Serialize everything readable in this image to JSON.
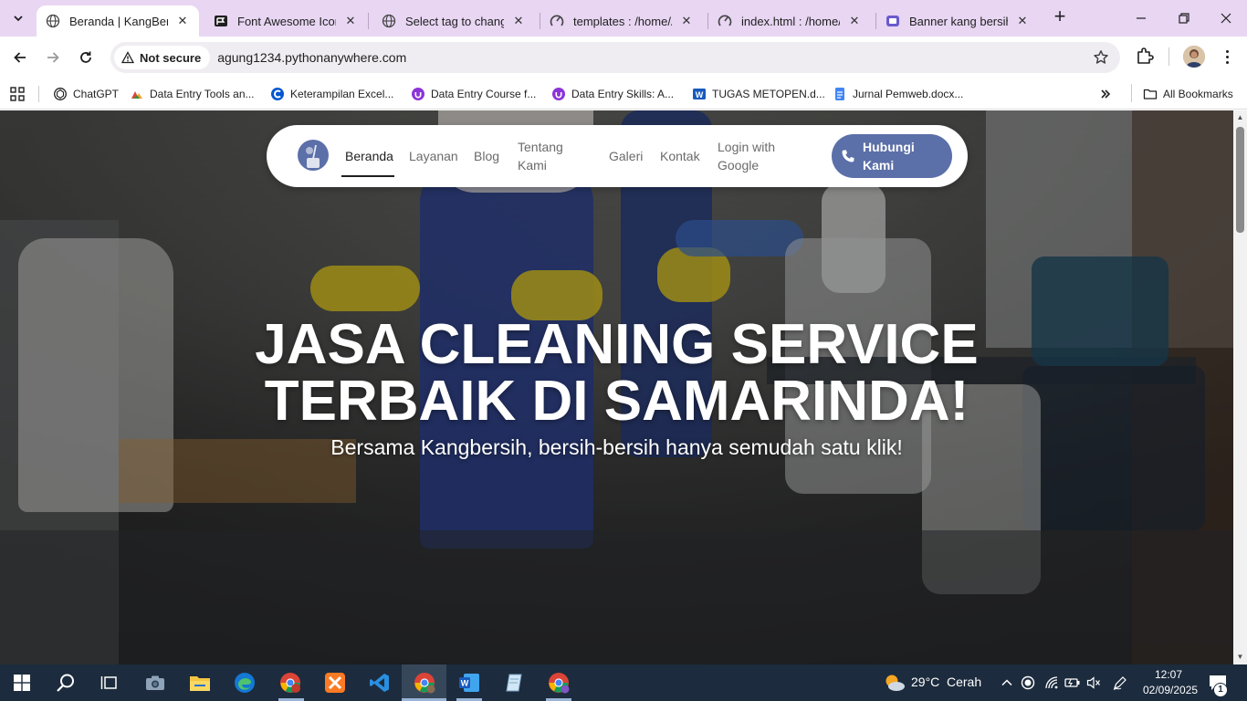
{
  "browser": {
    "tabs": [
      {
        "title": "Beranda | KangBersih",
        "icon": "kangbersih-favicon",
        "active": true
      },
      {
        "title": "Font Awesome Icons",
        "icon": "font-awesome-icon"
      },
      {
        "title": "Select tag to change",
        "icon": "globe-icon"
      },
      {
        "title": "templates : /home/Ag",
        "icon": "pythonanywhere-icon"
      },
      {
        "title": "index.html : /home/A",
        "icon": "pythonanywhere-icon"
      },
      {
        "title": "Banner kang bersih -",
        "icon": "canva-icon"
      }
    ],
    "security_label": "Not secure",
    "url": "agung1234.pythonanywhere.com",
    "bookmarks": [
      {
        "label": "ChatGPT",
        "icon": "chatgpt-icon"
      },
      {
        "label": "Data Entry Tools an...",
        "icon": "tools-icon"
      },
      {
        "label": "Keterampilan Excel...",
        "icon": "coursera-icon"
      },
      {
        "label": "Data Entry Course f...",
        "icon": "udemy-icon"
      },
      {
        "label": "Data Entry Skills: A...",
        "icon": "udemy-icon"
      },
      {
        "label": "TUGAS METOPEN.d...",
        "icon": "word-icon"
      },
      {
        "label": "Jurnal Pemweb.docx...",
        "icon": "docs-icon"
      }
    ],
    "all_bookmarks_label": "All Bookmarks"
  },
  "site": {
    "nav": {
      "links": [
        "Beranda",
        "Layanan",
        "Blog",
        "Tentang Kami",
        "Galeri",
        "Kontak",
        "Login with Google"
      ],
      "active": "Beranda",
      "cta_label": "Hubungi Kami"
    },
    "hero": {
      "title_line1": "JASA CLEANING SERVICE",
      "title_line2": "TERBAIK DI SAMARINDA!",
      "subtitle": "Bersama Kangbersih, bersih-bersih hanya semudah satu klik!"
    }
  },
  "taskbar": {
    "weather_temp": "29°C",
    "weather_text": "Cerah",
    "time": "12:07",
    "date": "02/09/2025",
    "notification_count": "1"
  },
  "colors": {
    "tabstrip": "#e8d6f3",
    "accent": "#5b6fa8",
    "taskbar": "#1c2b3d"
  }
}
